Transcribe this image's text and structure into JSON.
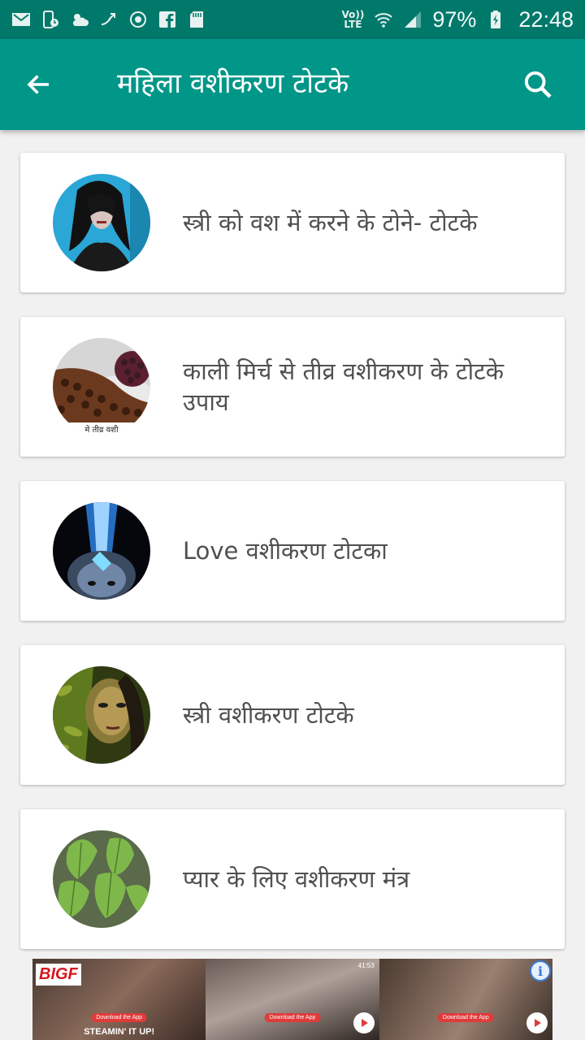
{
  "status_bar": {
    "battery": "97%",
    "time": "22:48",
    "lte_top": "Vo))",
    "lte_bottom": "LTE",
    "left_icons": [
      "mail-icon",
      "phone-timer-icon",
      "weather-icon",
      "transfer-icon",
      "sync-icon",
      "facebook-icon",
      "sd-card-icon"
    ],
    "right_icons": [
      "wifi-icon",
      "signal-icon",
      "battery-charging-icon"
    ]
  },
  "app_bar": {
    "title": "महिला वशीकरण टोटके",
    "back_icon": "arrow-back-icon",
    "search_icon": "search-icon"
  },
  "items": [
    {
      "label": "स्त्री को वश में करने के टोने- टोटके"
    },
    {
      "label": "काली मिर्च से तीव्र वशीकरण के टोटके उपाय"
    },
    {
      "label": "Love वशीकरण टोटका"
    },
    {
      "label": "स्त्री वशीकरण टोटके"
    },
    {
      "label": "प्यार के लिए वशीकरण मंत्र"
    }
  ],
  "thumb2_caption": "मे तीव्र वशी",
  "ad": {
    "logo": "BIGF",
    "caption": "STEAMIN' IT UP!",
    "download_label": "Download the App",
    "time": "41:53",
    "info_label": "i"
  },
  "colors": {
    "status_bar": "#00796b",
    "app_bar": "#009688",
    "text": "#505050",
    "background": "#f1f1f1"
  }
}
